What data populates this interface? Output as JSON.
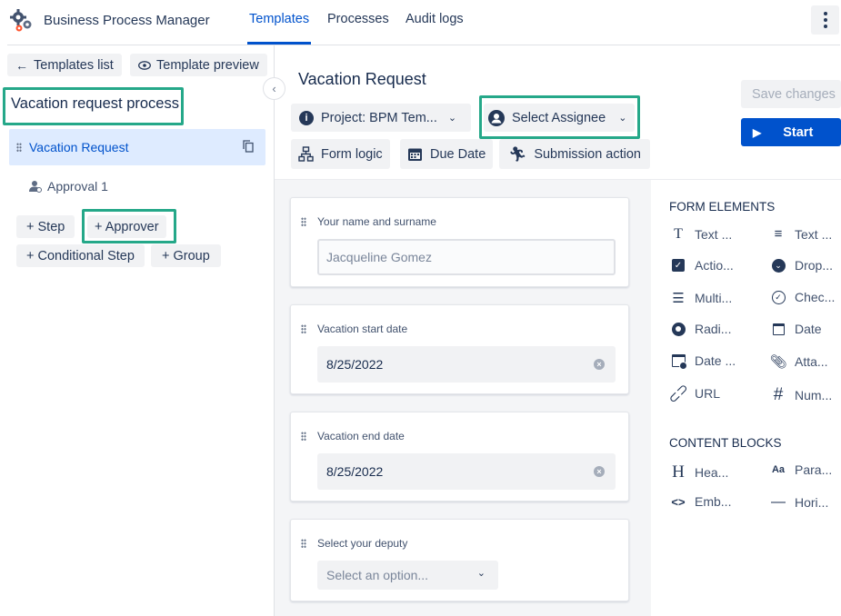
{
  "app": {
    "title": "Business Process Manager"
  },
  "nav": {
    "tabs": [
      "Templates",
      "Processes",
      "Audit logs"
    ],
    "active": "Templates"
  },
  "left": {
    "templates_list": "Templates list",
    "template_preview": "Template preview",
    "process_title": "Vacation request process",
    "steps": [
      "Vacation Request",
      "Approval 1"
    ],
    "add_step": "+ Step",
    "add_approver": "+ Approver",
    "add_conditional": "+ Conditional Step",
    "add_group": "+ Group"
  },
  "main": {
    "title": "Vacation Request",
    "project": "Project: BPM Tem...",
    "assignee": "Select Assignee",
    "form_logic": "Form logic",
    "due_date": "Due Date",
    "submission": "Submission action",
    "save": "Save changes",
    "start": "Start"
  },
  "form": {
    "name_label": "Your name and surname",
    "name_placeholder": "Jacqueline Gomez",
    "start_label": "Vacation start date",
    "start_value": "8/25/2022",
    "end_label": "Vacation end date",
    "end_value": "8/25/2022",
    "deputy_label": "Select your deputy",
    "deputy_placeholder": "Select an option..."
  },
  "palette": {
    "form_heading": "FORM ELEMENTS",
    "form_items": [
      "Text ...",
      "Text ...",
      "Actio...",
      "Drop...",
      "Multi...",
      "Chec...",
      "Radi...",
      "Date",
      "Date ...",
      "Atta...",
      "URL",
      "Num..."
    ],
    "content_heading": "CONTENT BLOCKS",
    "content_items": [
      "Hea...",
      "Para...",
      "Emb...",
      "Hori..."
    ]
  },
  "colors": {
    "accent": "#0052cc",
    "highlight": "#25a889",
    "selected_bg": "#deebff"
  }
}
